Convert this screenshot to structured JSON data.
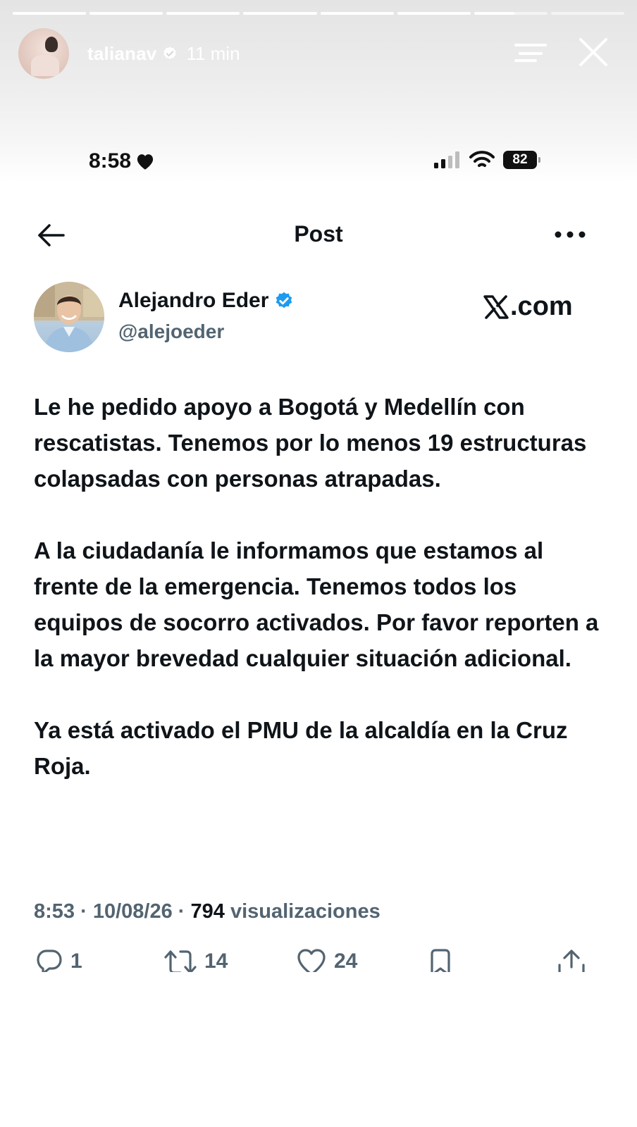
{
  "story": {
    "username": "talianav",
    "time": "11 min",
    "progress_segments": [
      1,
      1,
      1,
      1,
      1,
      1,
      0.55,
      0
    ]
  },
  "phone_status": {
    "time": "8:58",
    "battery": "82"
  },
  "post_header": {
    "title": "Post"
  },
  "author": {
    "name": "Alejandro Eder",
    "handle": "@alejoeder",
    "watermark": ".com"
  },
  "post": {
    "paragraphs": [
      "Le he pedido apoyo a Bogotá y Medellín con rescatistas. Tenemos por lo menos 19 estructuras colapsadas con personas atrapadas.",
      "A la ciudadanía le informamos que estamos al frente de la emergencia. Tenemos todos los equipos de socorro activados. Por favor reporten a la mayor brevedad cualquier situación adicional.",
      "Ya está activado el PMU de la alcaldía en la Cruz Roja."
    ],
    "time": "8:53",
    "date": "10/08/26",
    "views": "794",
    "views_label": "visualizaciones",
    "separator": " · "
  },
  "actions": {
    "replies": "1",
    "reposts": "14",
    "likes": "24"
  },
  "colors": {
    "verified_blue": "#1d9bf0",
    "text_primary": "#0f1419",
    "text_secondary": "#536471"
  }
}
